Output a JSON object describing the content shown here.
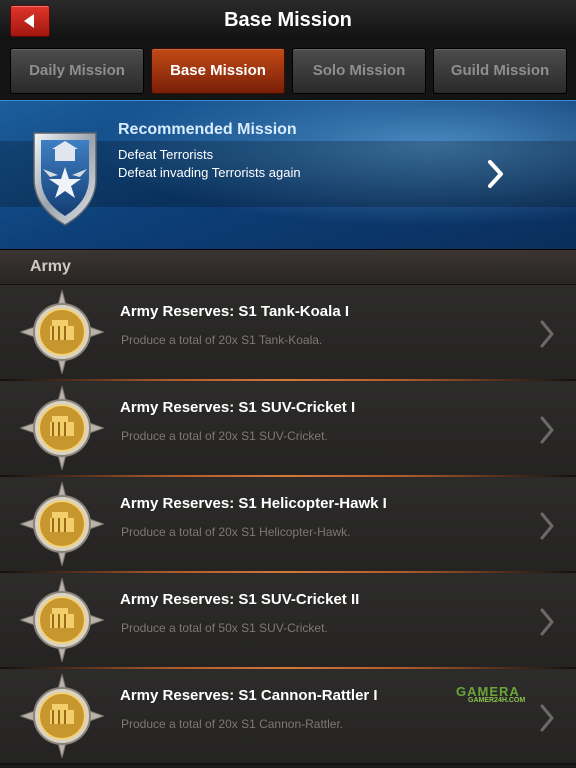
{
  "header": {
    "title": "Base Mission",
    "back_icon": "back-arrow-icon"
  },
  "tabs": [
    {
      "label": "Daily Mission",
      "active": false
    },
    {
      "label": "Base Mission",
      "active": true
    },
    {
      "label": "Solo Mission",
      "active": false
    },
    {
      "label": "Guild Mission",
      "active": false
    }
  ],
  "recommended": {
    "title": "Recommended Mission",
    "line1": "Defeat Terrorists",
    "line2": "Defeat invading Terrorists again",
    "icon": "shield-eagle-badge-icon"
  },
  "section": {
    "label": "Army"
  },
  "missions": [
    {
      "title": "Army Reserves: S1 Tank-Koala I",
      "desc": "Produce a total of 20x S1 Tank-Koala."
    },
    {
      "title": "Army Reserves: S1 SUV-Cricket I",
      "desc": "Produce a total of 20x S1 SUV-Cricket."
    },
    {
      "title": "Army Reserves: S1 Helicopter-Hawk I",
      "desc": "Produce a total of 20x S1 Helicopter-Hawk."
    },
    {
      "title": "Army Reserves: S1 SUV-Cricket II",
      "desc": "Produce a total of 50x S1 SUV-Cricket."
    },
    {
      "title": "Army Reserves: S1 Cannon-Rattler I",
      "desc": "Produce a total of 20x S1 Cannon-Rattler."
    }
  ],
  "watermark": {
    "main": "GAMERA",
    "sub": "GAMER24H.COM"
  },
  "colors": {
    "active_tab": "#c24a16",
    "back_button": "#d12a20",
    "banner_blue": "#1b5e9c"
  }
}
